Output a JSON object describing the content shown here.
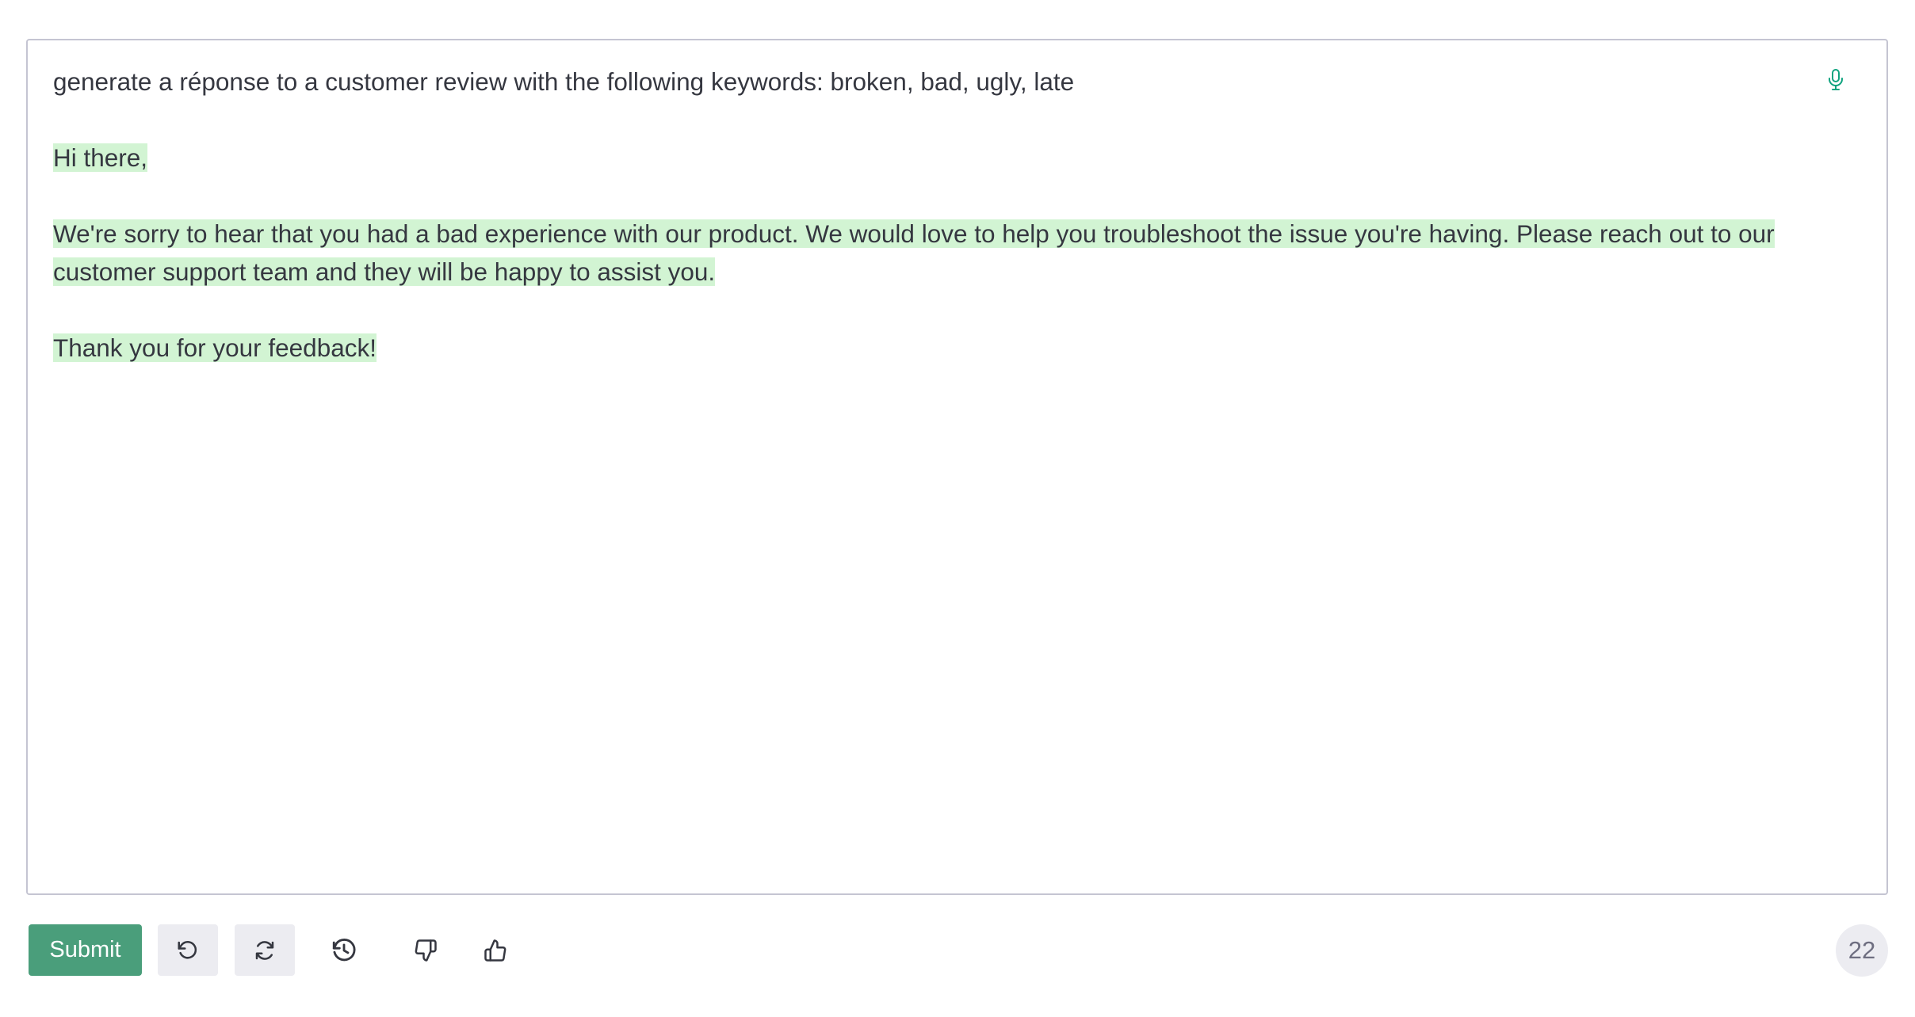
{
  "editor": {
    "prompt": "generate a réponse to a customer review with the following keywords: broken, bad, ugly, late",
    "completion": {
      "greeting": "Hi there,",
      "body": "We're sorry to hear that you had a bad experience with our product. We would love to help you troubleshoot the issue you're having. Please reach out to our customer support team and they will be happy to assist you.",
      "closing": "Thank you for your feedback!"
    },
    "mic_icon": "microphone-icon"
  },
  "toolbar": {
    "submit_label": "Submit",
    "undo_icon": "undo-icon",
    "regenerate_icon": "regenerate-icon",
    "history_icon": "history-icon",
    "thumbs_down_icon": "thumbs-down-icon",
    "thumbs_up_icon": "thumbs-up-icon",
    "token_count": "22"
  },
  "colors": {
    "accent": "#4a9e7b",
    "highlight": "#d2f4d3",
    "text": "#353740",
    "button_bg": "#ececf1",
    "border": "#c5c5d2"
  }
}
